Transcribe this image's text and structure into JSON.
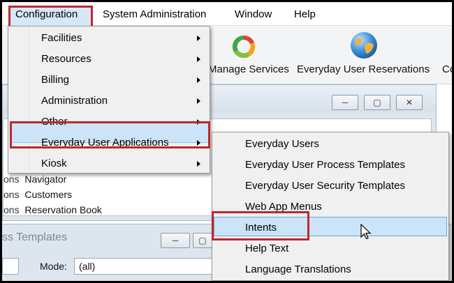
{
  "menubar": {
    "items": [
      {
        "label": "Configuration"
      },
      {
        "label": "System Administration"
      },
      {
        "label": "Window"
      },
      {
        "label": "Help"
      }
    ]
  },
  "toolbar": {
    "items": [
      {
        "label": "Manage Services",
        "icon": "manage-services-icon"
      },
      {
        "label": "Everyday User Reservations",
        "icon": "globe-icon"
      },
      {
        "label": "Co"
      }
    ]
  },
  "config_menu": {
    "items": [
      {
        "label": "Facilities",
        "has_submenu": true
      },
      {
        "label": "Resources",
        "has_submenu": true
      },
      {
        "label": "Billing",
        "has_submenu": true
      },
      {
        "label": "Administration",
        "has_submenu": true
      },
      {
        "label": "Other",
        "has_submenu": true
      },
      {
        "label": "Everyday User Applications",
        "has_submenu": true,
        "highlighted": true
      },
      {
        "label": "Kiosk",
        "has_submenu": true
      }
    ]
  },
  "submenu": {
    "items": [
      {
        "label": "Everyday Users"
      },
      {
        "label": "Everyday User Process Templates"
      },
      {
        "label": "Everyday User Security Templates"
      },
      {
        "label": "Web App Menus"
      },
      {
        "label": "Intents",
        "highlighted": true
      },
      {
        "label": "Help Text"
      },
      {
        "label": "Language Translations"
      }
    ]
  },
  "background_window": {
    "nav_rows": [
      {
        "prefix": "ons",
        "label": "Navigator"
      },
      {
        "prefix": "ons",
        "label": "Customers"
      },
      {
        "prefix": "ons",
        "label": "Reservation Book"
      }
    ]
  },
  "lower_window": {
    "title": "ss Templates",
    "mode_label": "Mode:",
    "mode_value": "(all)"
  },
  "colors": {
    "highlight_box": "#c0272d",
    "menu_hover": "#cce4f7",
    "menu_bg": "#f0f0f0"
  }
}
